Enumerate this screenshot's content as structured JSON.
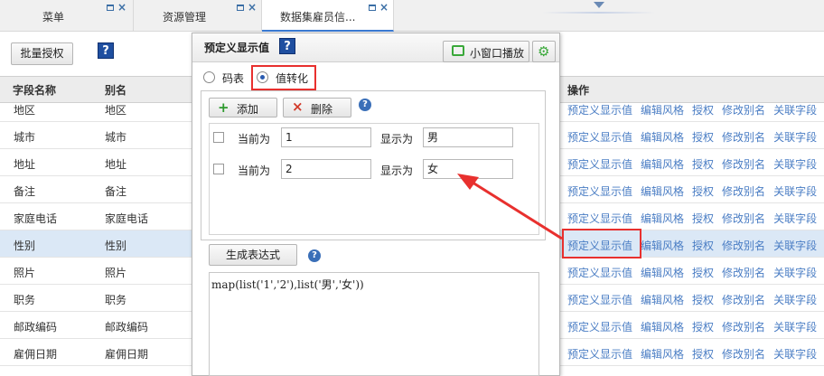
{
  "tabs": [
    {
      "label": "菜单"
    },
    {
      "label": "资源管理"
    },
    {
      "label": "数据集雇员信..."
    }
  ],
  "toolbar": {
    "batch_auth_label": "批量授权",
    "help_glyph": "?"
  },
  "table": {
    "columns": [
      "字段名称",
      "别名",
      "操作"
    ],
    "rows": [
      {
        "name": "地区",
        "alias": "地区"
      },
      {
        "name": "城市",
        "alias": "城市"
      },
      {
        "name": "地址",
        "alias": "地址"
      },
      {
        "name": "备注",
        "alias": "备注"
      },
      {
        "name": "家庭电话",
        "alias": "家庭电话"
      },
      {
        "name": "性别",
        "alias": "性别"
      },
      {
        "name": "照片",
        "alias": "照片"
      },
      {
        "name": "职务",
        "alias": "职务"
      },
      {
        "name": "邮政编码",
        "alias": "邮政编码"
      },
      {
        "name": "雇佣日期",
        "alias": "雇佣日期"
      }
    ],
    "actions": [
      "预定义显示值",
      "编辑风格",
      "授权",
      "修改别名",
      "关联字段"
    ],
    "selected_row": 5
  },
  "dialog": {
    "title": "预定义显示值",
    "help_glyph": "?",
    "mini_window_label": "小窗口播放",
    "radio_code_table": "码表",
    "radio_value_convert": "值转化",
    "add_label": "添加",
    "delete_label": "删除",
    "mappings": [
      {
        "current_label": "当前为",
        "current_value": "1",
        "display_label": "显示为",
        "display_value": "男"
      },
      {
        "current_label": "当前为",
        "current_value": "2",
        "display_label": "显示为",
        "display_value": "女"
      }
    ],
    "generate_label": "生成表达式",
    "expression": "map(list('1','2'),list('男','女'))"
  },
  "colors": {
    "accent": "#4a7dc4",
    "highlight": "#e8302e",
    "selected_row": "#dbe8f6"
  }
}
